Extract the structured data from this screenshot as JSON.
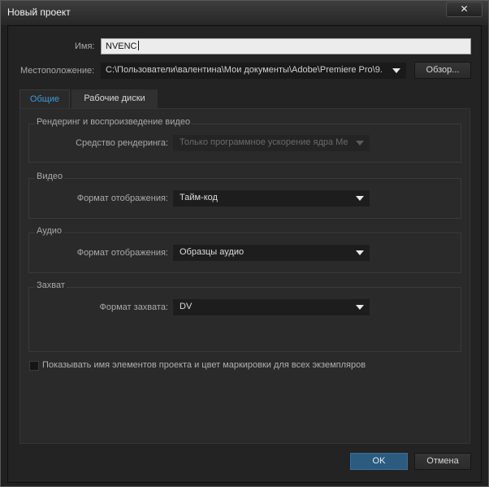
{
  "window": {
    "title": "Новый проект",
    "close_glyph": "✕"
  },
  "name_field": {
    "label": "Имя:",
    "value": "NVENC"
  },
  "location": {
    "label": "Местоположение:",
    "value": "C:\\Пользователи\\валентина\\Мои документы\\Adobe\\Premiere Pro\\9.",
    "browse_label": "Обзор..."
  },
  "tabs": [
    {
      "label": "Общие",
      "active": true
    },
    {
      "label": "Рабочие диски",
      "active": false
    }
  ],
  "groups": {
    "render": {
      "title": "Рендеринг и воспроизведение видео",
      "field_label": "Средство рендеринга:",
      "value": "Только программное ускорение ядра Me",
      "enabled": false
    },
    "video": {
      "title": "Видео",
      "field_label": "Формат отображения:",
      "value": "Тайм-код"
    },
    "audio": {
      "title": "Аудио",
      "field_label": "Формат отображения:",
      "value": "Образцы аудио"
    },
    "capture": {
      "title": "Захват",
      "field_label": "Формат захвата:",
      "value": "DV"
    }
  },
  "show_names_checkbox": {
    "label": "Показывать имя элементов проекта и цвет маркировки для всех экземпляров",
    "checked": false
  },
  "buttons": {
    "ok": "OK",
    "cancel": "Отмена"
  },
  "colors": {
    "accent": "#3d9ad8",
    "ok_button": "#2b5b7e",
    "background": "#2a2a2a"
  }
}
